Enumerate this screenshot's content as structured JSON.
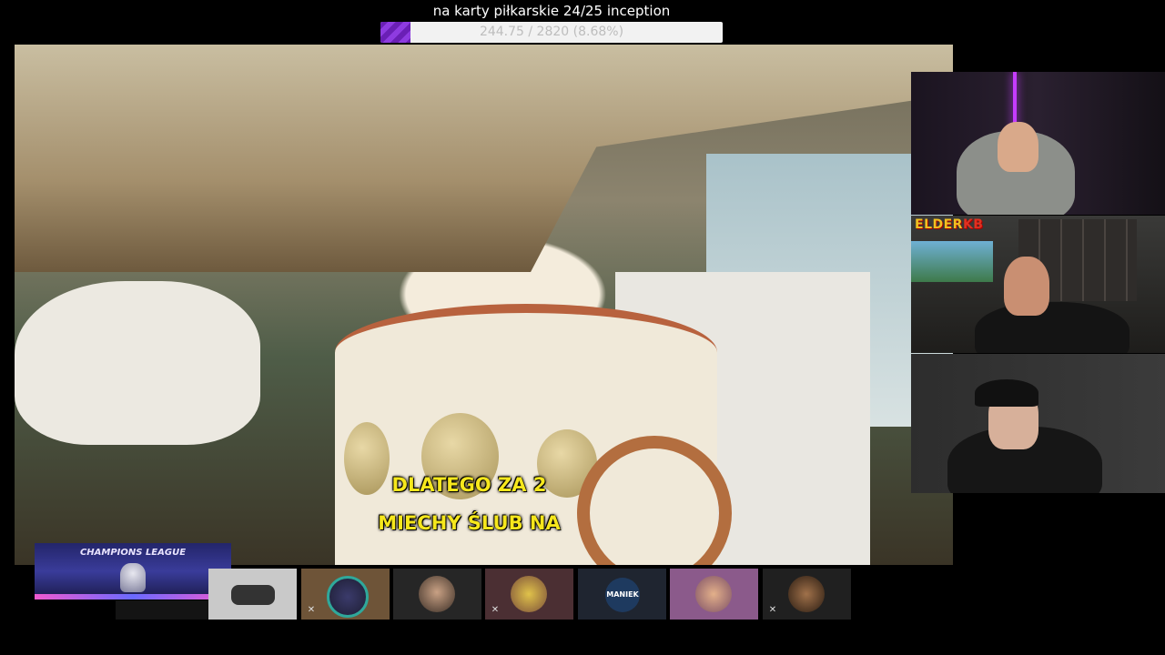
{
  "goal": {
    "title": "na karty piłkarskie 24/25 inception",
    "progress_text": "244.75 / 2820 (8.68%)",
    "current": 244.75,
    "target": 2820,
    "percent": 8.68,
    "fill_color": "#7a2bcf"
  },
  "video": {
    "subtitle_line1": "DLATEGO ZA 2",
    "subtitle_line2": "MIECHY ŚLUB NA",
    "subtitle_color": "#f6e71c"
  },
  "webcams": {
    "cam2_logo_part1": "ELDER",
    "cam2_logo_part2": "KB"
  },
  "banner": {
    "text": "CHAMPIONS LEAGUE"
  },
  "participants": [
    {
      "icon": "car-avatar",
      "muted": false
    },
    {
      "icon": "portrait-avatar",
      "muted": true
    },
    {
      "icon": "face-avatar",
      "muted": false
    },
    {
      "icon": "cartoon-avatar",
      "muted": true
    },
    {
      "icon": "logo-avatar",
      "label": "MANIEK",
      "muted": false
    },
    {
      "icon": "cartoon-face-avatar",
      "muted": false
    },
    {
      "icon": "creature-avatar",
      "muted": true
    }
  ]
}
